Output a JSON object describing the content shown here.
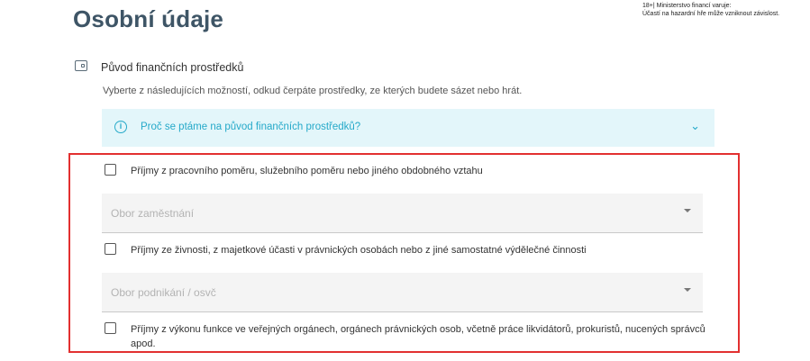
{
  "header": {
    "title": "Osobní údaje",
    "warning_line1": "18+| Ministerstvo financí varuje:",
    "warning_line2": "Účastí na hazardní hře může vzniknout závislost."
  },
  "section": {
    "icon": "wallet-icon",
    "title": "Původ finančních prostředků",
    "description": "Vyberte z následujících možností, odkud čerpáte prostředky, ze kterých budete sázet nebo hrát."
  },
  "info": {
    "icon": "info-icon",
    "icon_glyph": "i",
    "text": "Proč se ptáme na původ finančních prostředků?",
    "chevron_glyph": "⌄",
    "color": "#25a9c9",
    "background": "#e3f6fa"
  },
  "options": [
    {
      "label": "Příjmy z pracovního poměru, služebního poměru nebo jiného obdobného vztahu",
      "checked": false
    },
    {
      "label": "Příjmy ze živnosti, z majetkové účasti v právnických osobách nebo z jiné samostatné výdělečné činnosti",
      "checked": false
    },
    {
      "label": "Příjmy z výkonu funkce ve veřejných orgánech, orgánech právnických osob, včetně práce likvidátorů, prokuristů, nucených správců apod.",
      "checked": false
    }
  ],
  "dropdowns": [
    {
      "placeholder": "Obor zaměstnání"
    },
    {
      "placeholder": "Obor podnikání / osvč"
    }
  ],
  "highlight_color": "#e23030"
}
